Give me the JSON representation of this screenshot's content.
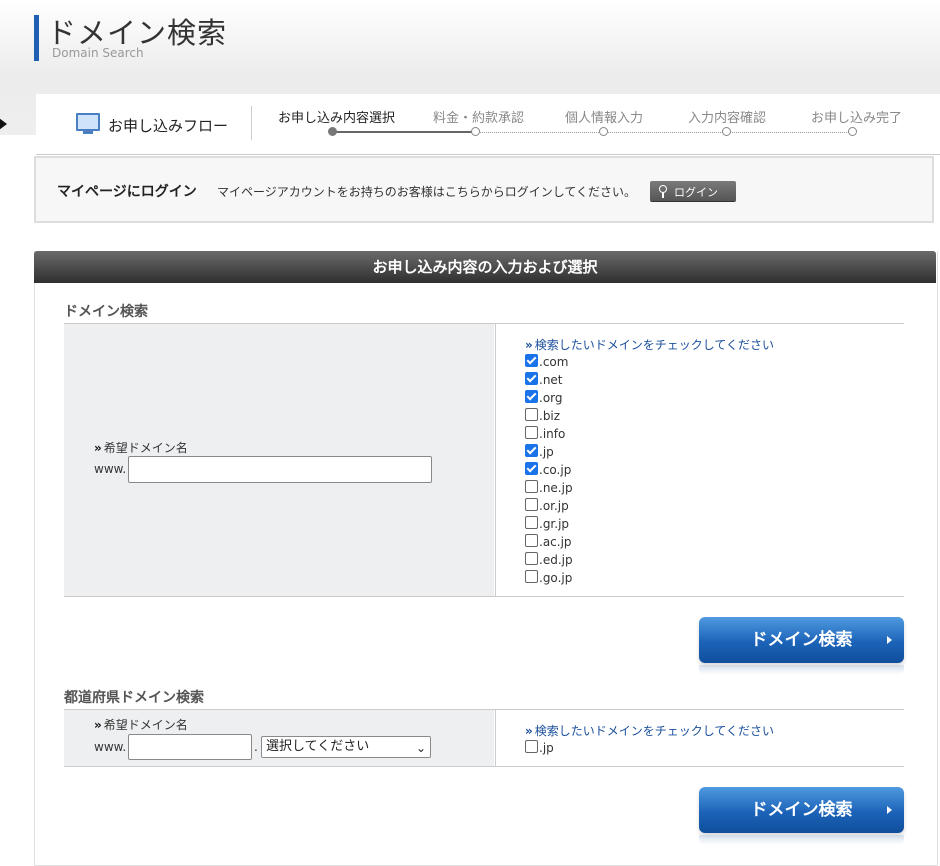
{
  "header": {
    "title": "ドメイン検索",
    "subtitle": "Domain Search"
  },
  "flow": {
    "label": "お申し込みフロー",
    "steps": [
      {
        "label": "お申し込み内容選択",
        "active": true
      },
      {
        "label": "料金・約款承認",
        "active": false
      },
      {
        "label": "個人情報入力",
        "active": false
      },
      {
        "label": "入力内容確認",
        "active": false
      },
      {
        "label": "お申し込み完了",
        "active": false
      }
    ]
  },
  "login": {
    "title": "マイページにログイン",
    "description": "マイページアカウントをお持ちのお客様はこちらからログインしてください。",
    "button": "ログイン"
  },
  "panel": {
    "header": "お申し込み内容の入力および選択"
  },
  "domain_search": {
    "title": "ドメイン検索",
    "field_label": "希望ドメイン名",
    "prefix": "www.",
    "input_value": "",
    "check_hint": "検索したいドメインをチェックしてください",
    "tlds": [
      {
        "label": ".com",
        "checked": true
      },
      {
        "label": ".net",
        "checked": true
      },
      {
        "label": ".org",
        "checked": true
      },
      {
        "label": ".biz",
        "checked": false
      },
      {
        "label": ".info",
        "checked": false
      },
      {
        "label": ".jp",
        "checked": true
      },
      {
        "label": ".co.jp",
        "checked": true
      },
      {
        "label": ".ne.jp",
        "checked": false
      },
      {
        "label": ".or.jp",
        "checked": false
      },
      {
        "label": ".gr.jp",
        "checked": false
      },
      {
        "label": ".ac.jp",
        "checked": false
      },
      {
        "label": ".ed.jp",
        "checked": false
      },
      {
        "label": ".go.jp",
        "checked": false
      }
    ],
    "button": "ドメイン検索"
  },
  "pref_search": {
    "title": "都道府県ドメイン検索",
    "field_label": "希望ドメイン名",
    "prefix": "www.",
    "input_value": "",
    "separator": ".",
    "select_value": "選択してください",
    "check_hint": "検索したいドメインをチェックしてください",
    "tlds": [
      {
        "label": ".jp",
        "checked": false
      }
    ],
    "button": "ドメイン検索"
  },
  "colors": {
    "accent": "#1f5fb4",
    "button": "#1c63b8",
    "checkbox": "#1a73e8"
  }
}
